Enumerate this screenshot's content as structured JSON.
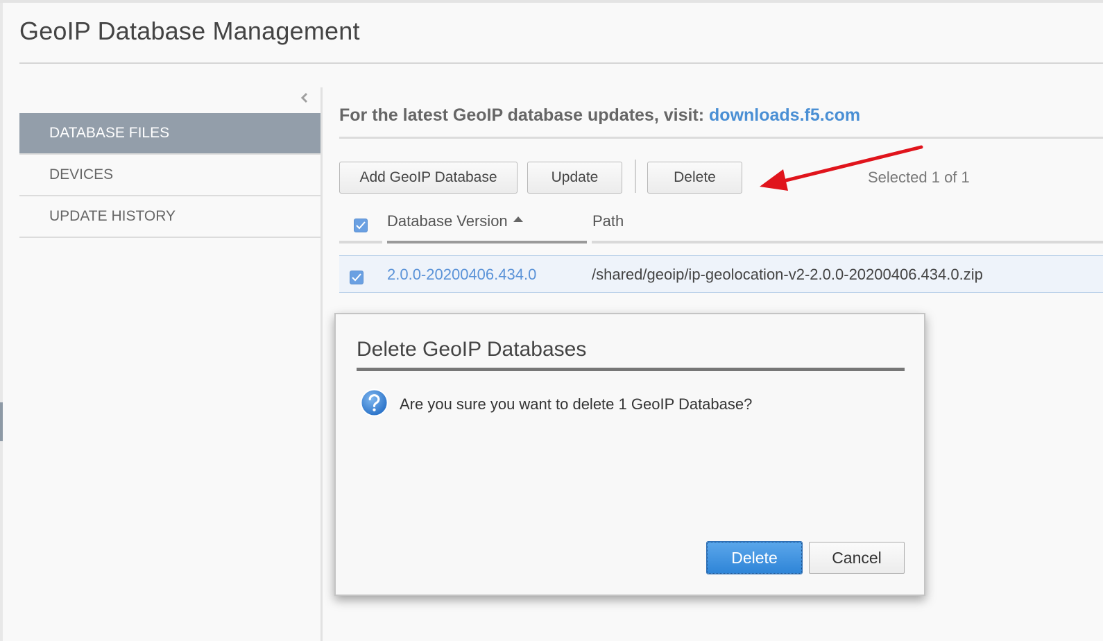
{
  "page": {
    "title": "GeoIP Database Management"
  },
  "sidebar": {
    "items": [
      {
        "label": "DATABASE FILES",
        "active": true
      },
      {
        "label": "DEVICES",
        "active": false
      },
      {
        "label": "UPDATE HISTORY",
        "active": false
      }
    ]
  },
  "main": {
    "info_text": "For the latest GeoIP database updates, visit: ",
    "info_link": "downloads.f5.com",
    "toolbar": {
      "add_label": "Add GeoIP Database",
      "update_label": "Update",
      "delete_label": "Delete",
      "selected_text": "Selected 1 of 1"
    },
    "table": {
      "header_version": "Database Version",
      "header_path": "Path",
      "sort": "ascending",
      "rows": [
        {
          "selected": true,
          "version": "2.0.0-20200406.434.0",
          "path": "/shared/geoip/ip-geolocation-v2-2.0.0-20200406.434.0.zip"
        }
      ]
    }
  },
  "dialog": {
    "title": "Delete GeoIP Databases",
    "message": "Are you sure you want to delete 1 GeoIP Database?",
    "delete_label": "Delete",
    "cancel_label": "Cancel"
  },
  "colors": {
    "accent": "#4a8fd4",
    "sidebar_active": "#939eaa",
    "primary_button": "#2f85d8",
    "annotation_arrow": "#e0141c"
  },
  "icons": [
    "collapse-chevron-icon",
    "checkbox-checked-icon",
    "sort-ascending-icon",
    "question-icon",
    "annotation-arrow"
  ]
}
